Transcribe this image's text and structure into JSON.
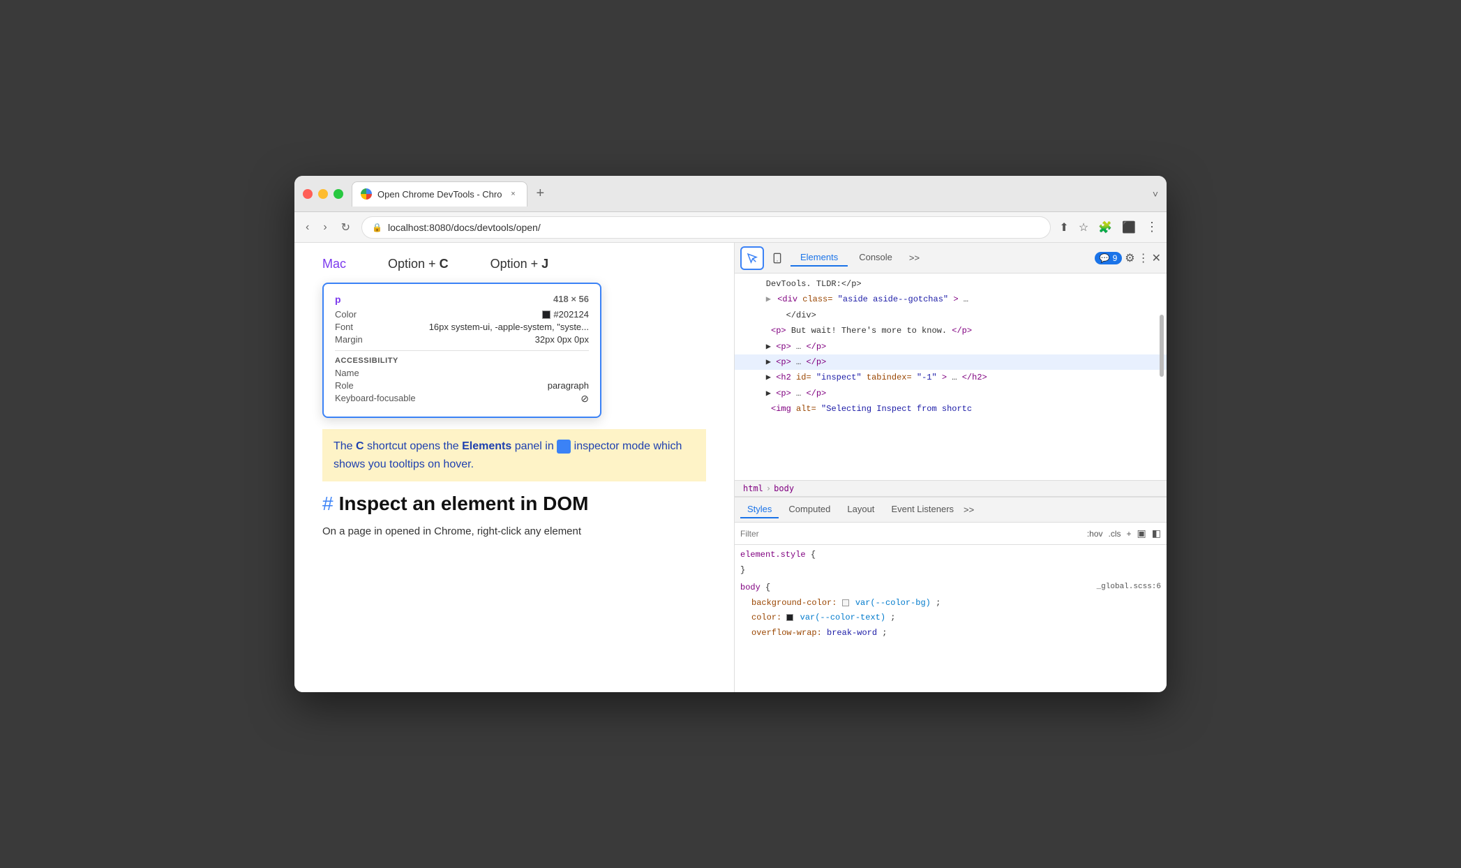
{
  "window": {
    "title": "Open Chrome DevTools - Chrome"
  },
  "tab": {
    "label": "Open Chrome DevTools - Chro",
    "close": "×",
    "new": "+"
  },
  "address_bar": {
    "url": "localhost:8080/docs/devtools/open/",
    "back": "‹",
    "forward": "›",
    "refresh": "↻"
  },
  "page": {
    "platform": "Mac",
    "shortcut1_label": "Option + C",
    "shortcut2_label": "Option + J",
    "tooltip": {
      "tag": "p",
      "size": "418 × 56",
      "color_label": "Color",
      "color_value": "#202124",
      "font_label": "Font",
      "font_value": "16px system-ui, -apple-system, \"syste...",
      "margin_label": "Margin",
      "margin_value": "32px 0px 0px",
      "accessibility_label": "ACCESSIBILITY",
      "name_label": "Name",
      "name_value": "",
      "role_label": "Role",
      "role_value": "paragraph",
      "keyboard_label": "Keyboard-focusable",
      "keyboard_value": "⊘"
    },
    "highlight_text": "The C shortcut opens the Elements panel in inspector mode which shows you tooltips on hover.",
    "heading_hash": "#",
    "heading": "Inspect an element in DOM",
    "body_text": "On a page in opened in Chrome, right-click any element"
  },
  "devtools": {
    "tabs": [
      "Elements",
      "Console"
    ],
    "more_tabs": "»",
    "badge_count": "9",
    "dom_lines": [
      {
        "indent": 0,
        "content": "DevTools. TLDR:</p>",
        "arrow": "",
        "selected": false
      },
      {
        "indent": 1,
        "content": "<div class=\"aside aside--gotchas\">…",
        "arrow": "▶",
        "selected": false
      },
      {
        "indent": 2,
        "content": "</div>",
        "arrow": "",
        "selected": false
      },
      {
        "indent": 1,
        "content": "<p>But wait! There's more to know.</p>",
        "arrow": "",
        "selected": false
      },
      {
        "indent": 1,
        "content": "<p>…</p>",
        "arrow": "▶",
        "selected": false
      },
      {
        "indent": 1,
        "content": "<p>…</p>",
        "arrow": "▶",
        "selected": true
      },
      {
        "indent": 1,
        "content": "<h2 id=\"inspect\" tabindex=\"-1\">…</h2>",
        "arrow": "▶",
        "selected": false
      },
      {
        "indent": 1,
        "content": "<p>…</p>",
        "arrow": "▶",
        "selected": false
      },
      {
        "indent": 1,
        "content": "<img alt=\"Selecting Inspect from shortc",
        "arrow": "",
        "selected": false
      }
    ],
    "breadcrumb": [
      "html",
      "body"
    ],
    "styles_tabs": [
      "Styles",
      "Computed",
      "Layout",
      "Event Listeners"
    ],
    "styles_more": "»",
    "filter_placeholder": "Filter",
    "filter_hov": ":hov",
    "filter_cls": ".cls",
    "filter_plus": "+",
    "css_rules": [
      {
        "selector": "element.style",
        "file": "",
        "properties": [
          {
            "prop": "",
            "value": "{"
          },
          {
            "prop": "",
            "value": "}"
          }
        ]
      },
      {
        "selector": "body",
        "file": "_global.scss:6",
        "properties": [
          {
            "prop": "background-color:",
            "value": "var(--color-bg)",
            "has_swatch": true,
            "swatch_color": "#f5f5f5"
          },
          {
            "prop": "color:",
            "value": "var(--color-text)",
            "has_swatch": true,
            "swatch_color": "#202124"
          },
          {
            "prop": "overflow-wrap:",
            "value": "break-word"
          }
        ]
      }
    ]
  }
}
